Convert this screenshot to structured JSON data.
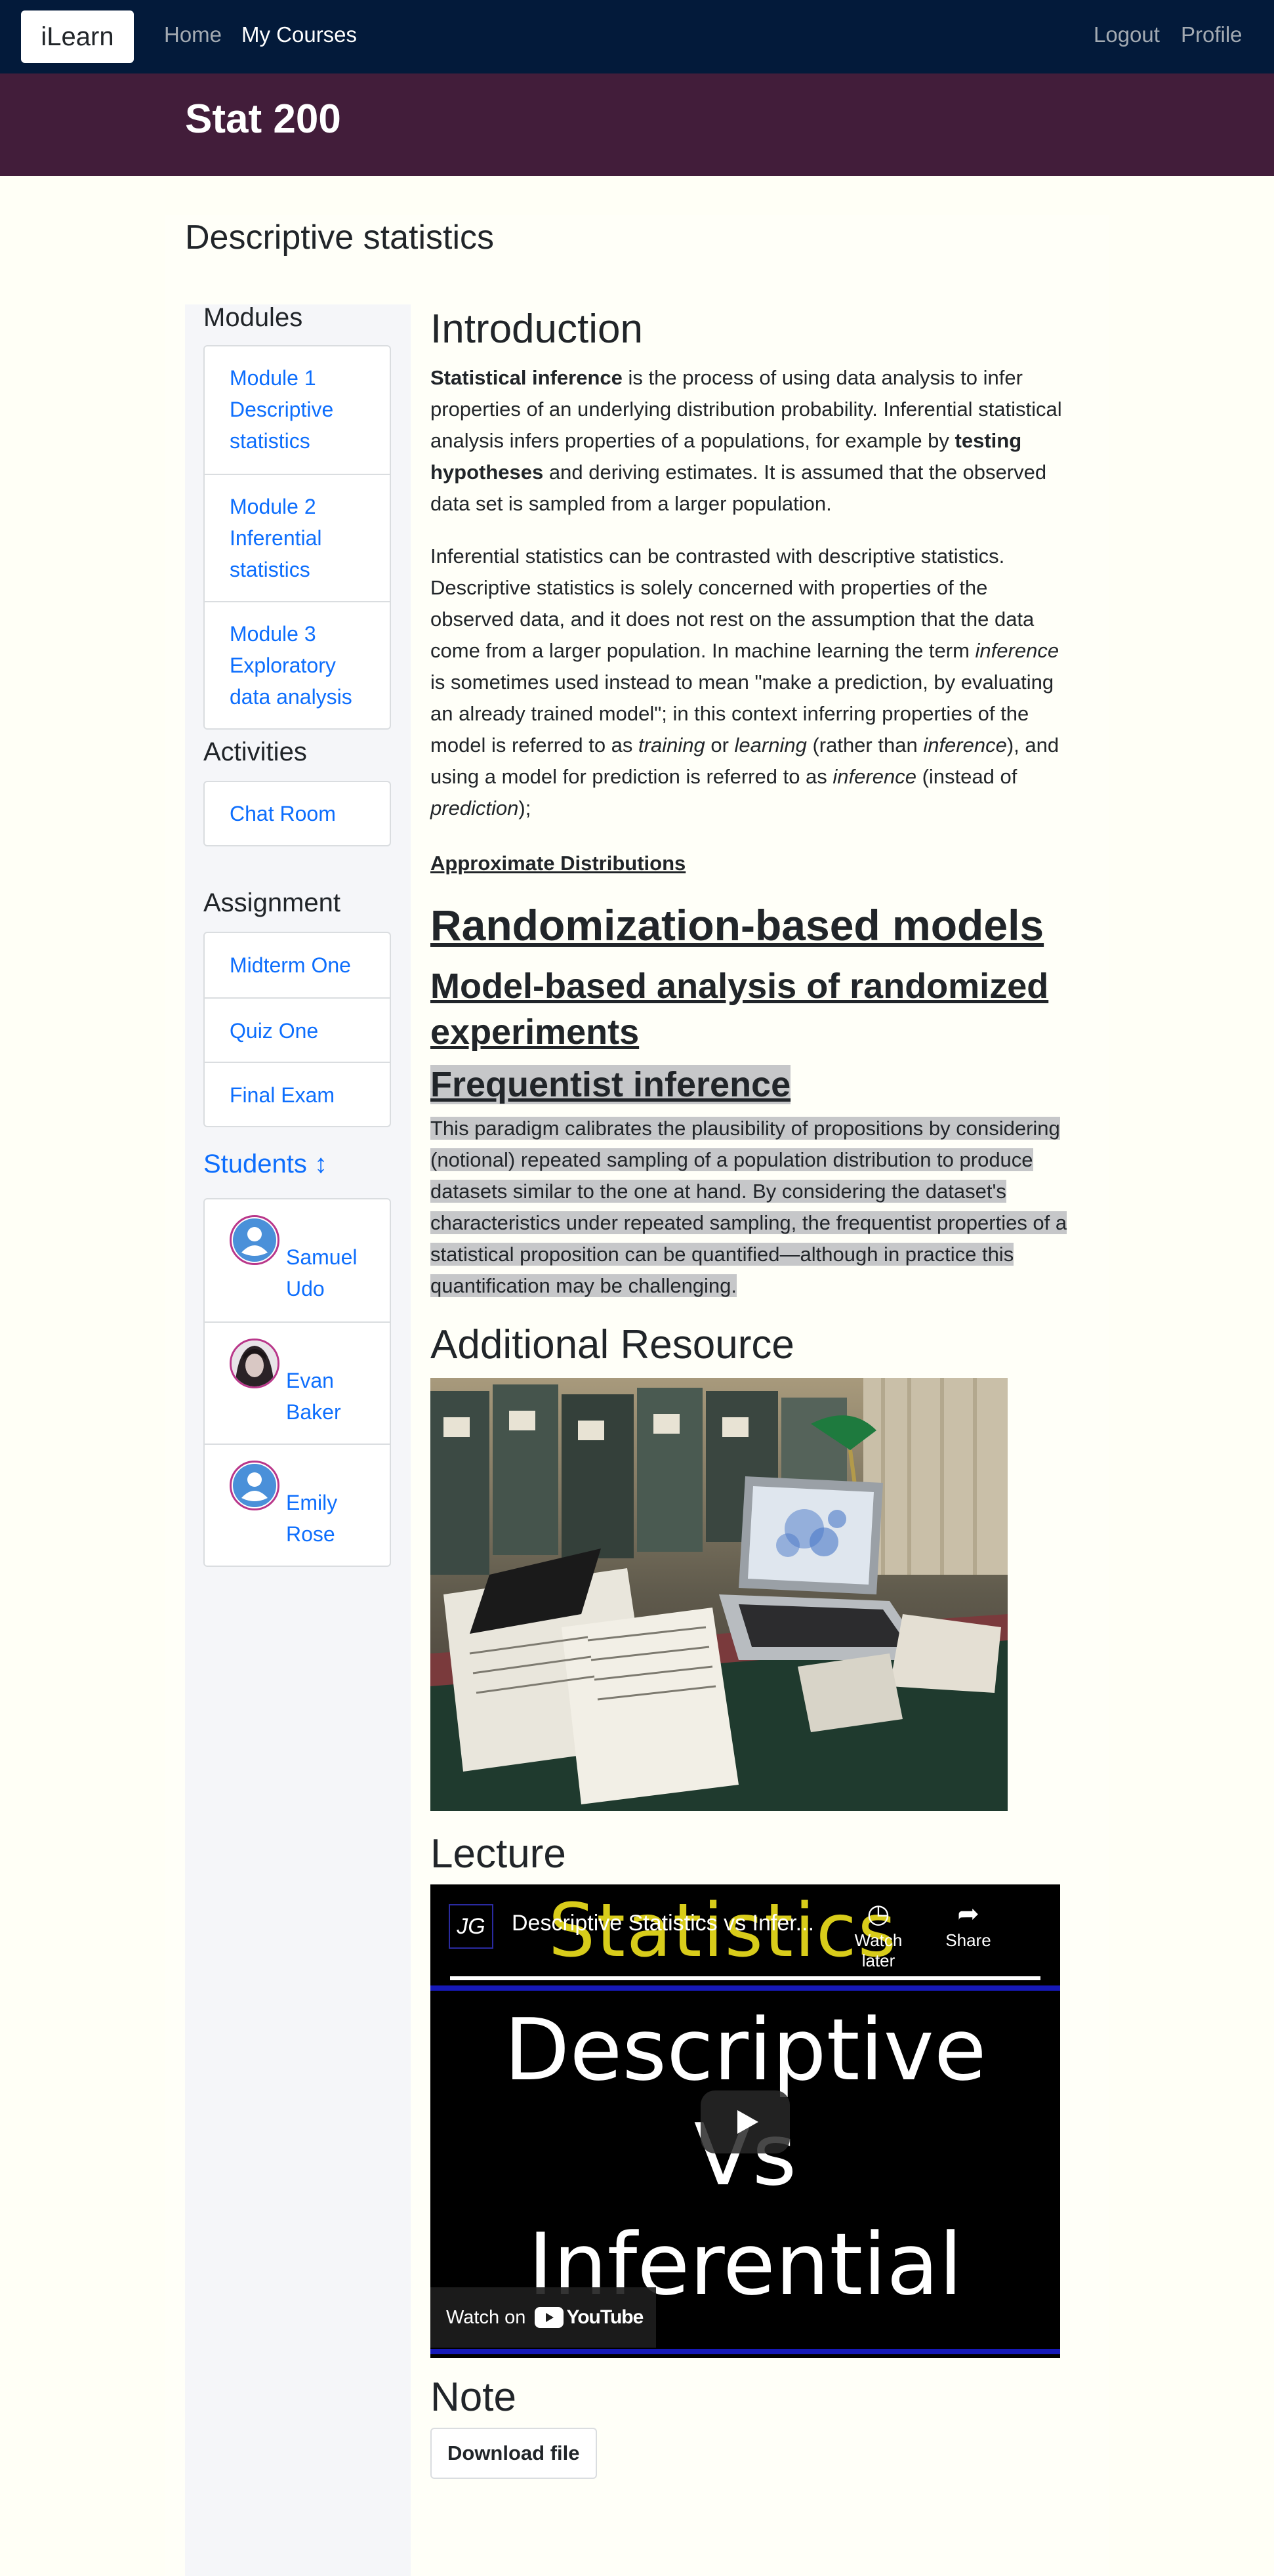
{
  "nav": {
    "brand": "iLearn",
    "links": [
      "Home",
      "My Courses"
    ],
    "right_links": [
      "Logout",
      "Profile"
    ]
  },
  "course": {
    "title": "Stat 200"
  },
  "page": {
    "title": "Descriptive statistics"
  },
  "sidebar": {
    "modules_heading": "Modules",
    "modules": [
      [
        "Module 1",
        "Descriptive",
        "statistics"
      ],
      [
        "Module 2",
        "Inferential",
        "statistics"
      ],
      [
        "Module 3",
        "Exploratory",
        "data analysis"
      ]
    ],
    "activities_heading": "Activities",
    "activities": [
      "Chat Room"
    ],
    "assignment_heading": "Assignment",
    "assignments": [
      "Midterm One",
      "Quiz One",
      "Final Exam"
    ],
    "students_heading": "Students ↕",
    "students": [
      {
        "first": "Samuel",
        "last": "Udo",
        "avatar": "user-icon"
      },
      {
        "first": "Evan",
        "last": "Baker",
        "avatar": "photo"
      },
      {
        "first": "Emily",
        "last": "Rose",
        "avatar": "user-icon"
      }
    ]
  },
  "content": {
    "intro_heading": "Introduction",
    "p1": {
      "b1": "Statistical inference",
      "t1": " is the process of using data analysis to infer properties of an underlying distribution probability. Inferential statistical analysis infers properties of a populations, for example by ",
      "b2": "testing hypotheses",
      "t2": " and deriving estimates. It is assumed that the observed data set is sampled from a larger population."
    },
    "p2": {
      "t1": "Inferential statistics can be contrasted with descriptive statistics. Descriptive statistics is solely concerned with properties of the observed data, and it does not rest on the assumption that the data come from a larger population. In machine learning the term ",
      "i1": "inference",
      "t2": " is sometimes used instead to mean \"make a prediction, by evaluating an already trained model\"; in this context inferring properties of the model is referred to as ",
      "i2": "training",
      "t3": " or ",
      "i3": "learning",
      "t4": " (rather than ",
      "i4": "inference",
      "t5": "), and using a model for prediction is referred to as ",
      "i5": "inference",
      "t6": " (instead of ",
      "i6": "prediction",
      "t7": ");"
    },
    "approx_link": "Approximate Distributions",
    "link_randomization": "Randomization-based models",
    "link_model_based": "Model-based analysis of randomized experiments",
    "link_frequentist": "Frequentist inference",
    "frequentist_text": "This paradigm calibrates the plausibility of propositions by considering (notional) repeated sampling of a population distribution to produce datasets similar to the one at hand. By considering the dataset's characteristics under repeated sampling, the frequentist properties of a statistical proposition can be quantified—although in practice this quantification may be challenging.",
    "resource_heading": "Additional Resource",
    "lecture_heading": "Lecture",
    "video": {
      "channel": "JG",
      "title": "Descriptive Statistics vs Infer...",
      "watch_later": "Watch later",
      "share": "Share",
      "banner": "Statistics",
      "line1": "Descriptive",
      "line2": "Vs",
      "line3": "Inferential",
      "watch_on": "Watch on",
      "youtube": "YouTube"
    },
    "note_heading": "Note",
    "download_label": "Download file"
  }
}
